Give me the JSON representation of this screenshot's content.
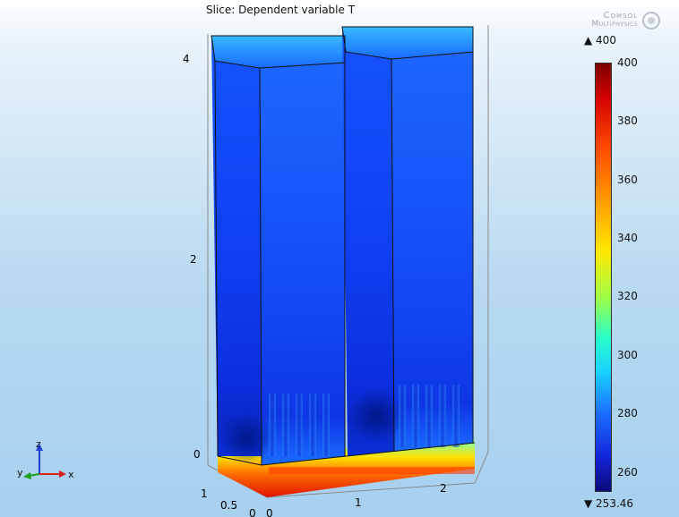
{
  "plot": {
    "title": "Slice: Dependent variable T"
  },
  "logo": {
    "line1": "Comsol",
    "line2": "Multiphysics"
  },
  "colorbar": {
    "max_label": "▲ 400",
    "min_label": "▼ 253.46",
    "ticks": [
      "400",
      "380",
      "360",
      "340",
      "320",
      "300",
      "280",
      "260"
    ],
    "range": [
      253.46,
      400
    ]
  },
  "axes": {
    "z_ticks": [
      "4",
      "2",
      "0"
    ],
    "x_ticks": [
      "0",
      "1",
      "2"
    ],
    "y_ticks": [
      "1",
      "0.5",
      "0"
    ]
  },
  "triad": {
    "x": "x",
    "y": "y",
    "z": "z",
    "colors": {
      "x": "#d62020",
      "y": "#1fa01f",
      "z": "#1f3fd6"
    }
  }
}
